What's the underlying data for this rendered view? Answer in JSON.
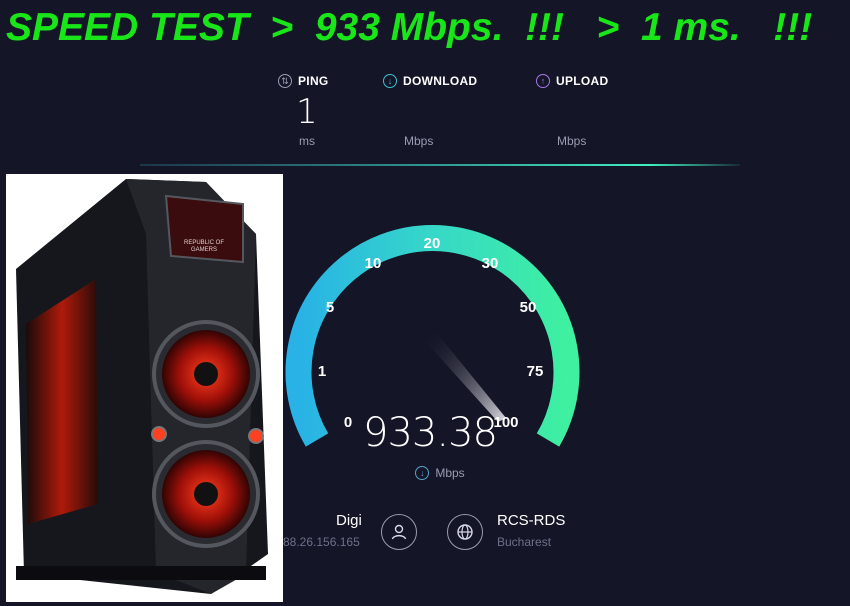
{
  "headline": "SPEED TEST  >  933 Mbps.  !!!   >  1 ms.   !!!",
  "metrics": {
    "ping": {
      "label": "PING",
      "value": "1",
      "unit": "ms",
      "icon": "ping-icon",
      "color": "#9a9cb2"
    },
    "download": {
      "label": "DOWNLOAD",
      "unit": "Mbps",
      "icon": "download-arrow-icon",
      "color": "#3ec1d3"
    },
    "upload": {
      "label": "UPLOAD",
      "unit": "Mbps",
      "icon": "upload-arrow-icon",
      "color": "#a777e3"
    }
  },
  "gauge": {
    "ticks": [
      "0",
      "1",
      "5",
      "10",
      "20",
      "30",
      "50",
      "75",
      "100"
    ],
    "reading": "933.38",
    "unit": "Mbps",
    "needle_fraction": 1.0,
    "arc_start_color": "#28b2e6",
    "arc_end_color": "#3ff0a0"
  },
  "isp": {
    "name": "Digi",
    "ip": "88.26.156.165",
    "server_name": "RCS-RDS",
    "server_location": "Bucharest"
  },
  "photo": {
    "badge_text_1": "REPUBLIC OF",
    "badge_text_2": "GAMERS"
  },
  "colors": {
    "background": "#141526",
    "headline": "#19e619",
    "accent": "#3ec1d3"
  }
}
